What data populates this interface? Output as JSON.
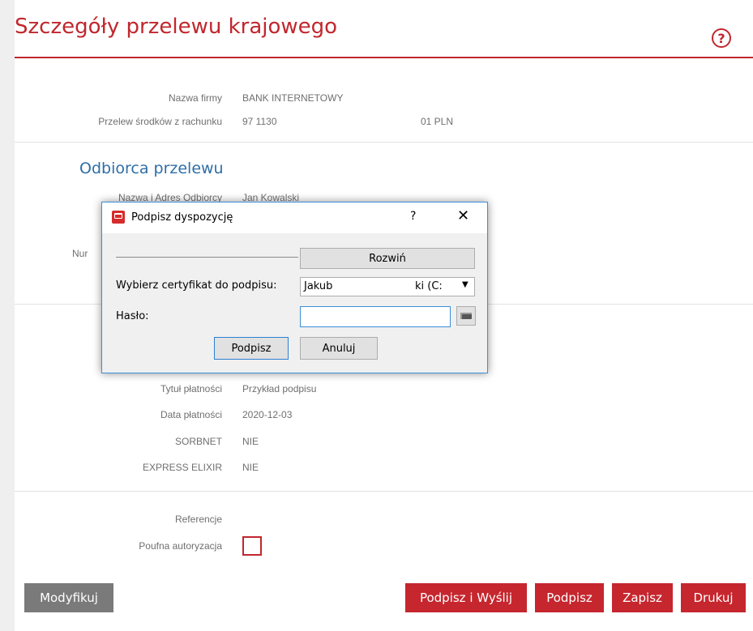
{
  "page": {
    "title": "Szczegóły przelewu krajowego",
    "help_glyph": "?"
  },
  "details": {
    "company_label": "Nazwa firmy",
    "company_value": "BANK INTERNETOWY",
    "account_label": "Przelew środków z rachunku",
    "account_value": "97 1130",
    "balance_value": "01 PLN"
  },
  "recipient": {
    "heading": "Odbiorca przelewu",
    "name_label": "Nazwa i Adres Odbiorcy",
    "name_value": "Jan Kowalski",
    "number_label_partial": "Nur"
  },
  "payment": {
    "title_label": "Tytuł płatności",
    "title_value": "Przykład podpisu",
    "date_label": "Data płatności",
    "date_value": "2020-12-03",
    "sorbnet_label": "SORBNET",
    "sorbnet_value": "NIE",
    "elixir_label": "EXPRESS ELIXIR",
    "elixir_value": "NIE",
    "ref_label": "Referencje",
    "auth_label": "Poufna autoryzacja"
  },
  "buttons": {
    "modify": "Modyfikuj",
    "sign_send": "Podpisz i Wyślij",
    "sign": "Podpisz",
    "save": "Zapisz",
    "print": "Drukuj"
  },
  "dialog": {
    "title": "Podpisz dyspozycję",
    "help": "?",
    "close": "✕",
    "expand_label": "Rozwiń",
    "cert_label": "Wybierz certyfikat do podpisu:",
    "cert_value_start": "Jakub",
    "cert_value_end": "ki (C:",
    "cert_caret": "▼",
    "password_label": "Hasło:",
    "sign_button": "Podpisz",
    "cancel_button": "Anuluj"
  },
  "colors": {
    "accent_red": "#c0272d",
    "heading_blue": "#2e6ea6",
    "focus_blue": "#3c8fd8"
  }
}
